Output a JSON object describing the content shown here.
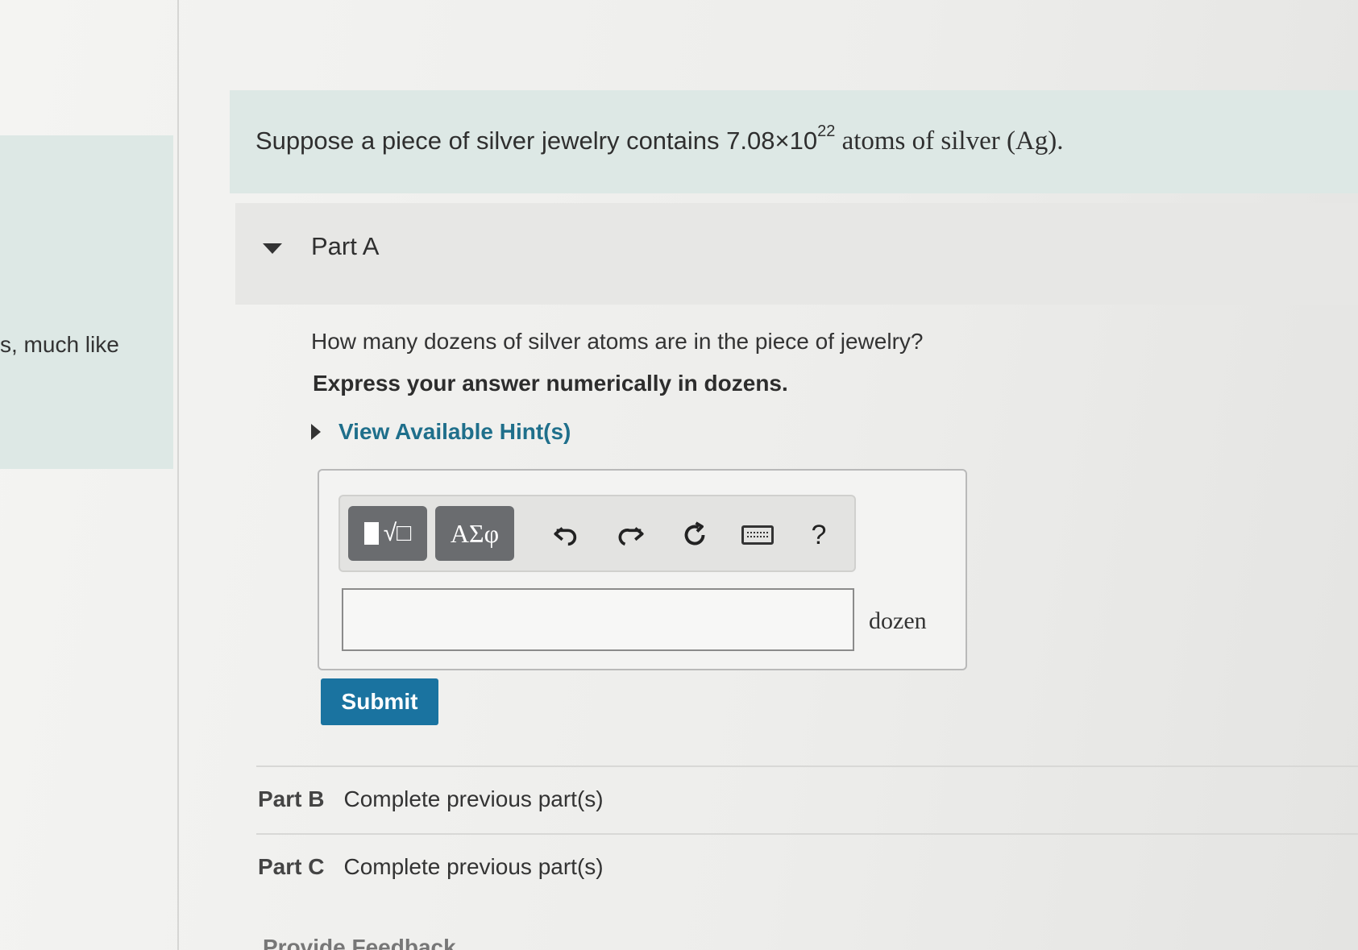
{
  "left_panel": {
    "fragment_text": "s, much like"
  },
  "problem": {
    "prefix": "Suppose a piece of silver jewelry contains ",
    "mantissa": "7.08×10",
    "exponent": "22",
    "suffix": " atoms of silver (Ag)."
  },
  "part_a": {
    "title": "Part A",
    "question": "How many dozens of silver atoms are in the piece of jewelry?",
    "instruction": "Express your answer numerically in dozens.",
    "hint_label": "View Available Hint(s)",
    "toolbar": {
      "templates_label": "√□",
      "greek_label": "ΑΣφ",
      "undo_icon": "undo-icon",
      "redo_icon": "redo-icon",
      "reset_icon": "reset-icon",
      "keyboard_icon": "keyboard-icon",
      "help_label": "?"
    },
    "answer_value": "",
    "unit": "dozen",
    "submit_label": "Submit"
  },
  "part_b": {
    "label": "Part B",
    "status": "Complete previous part(s)"
  },
  "part_c": {
    "label": "Part C",
    "status": "Complete previous part(s)"
  },
  "feedback_label": "Provide Feedback"
}
